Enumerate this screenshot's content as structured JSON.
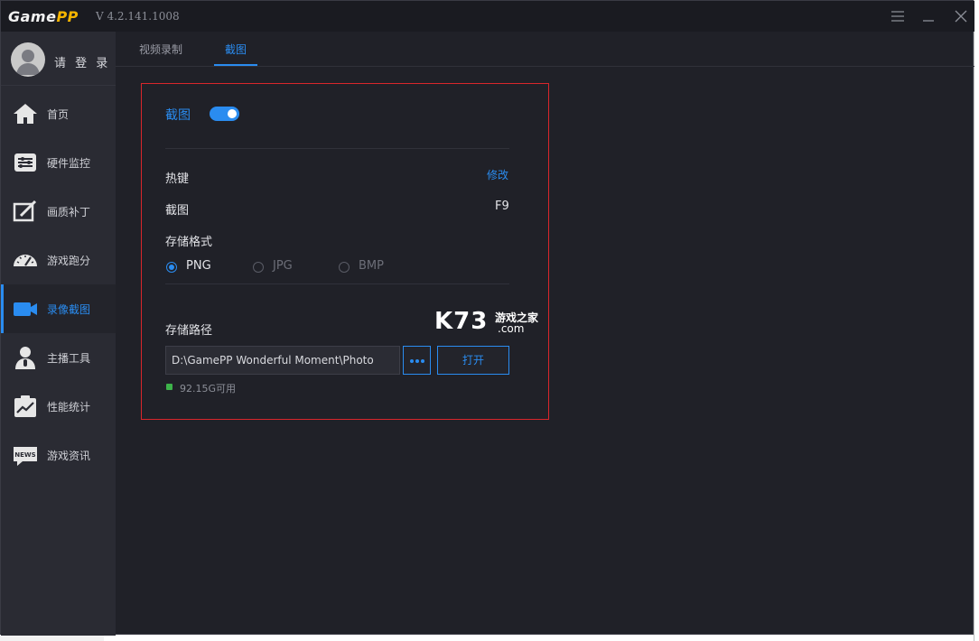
{
  "app": {
    "logo_main": "Game",
    "logo_accent": "PP",
    "version": "V 4.2.141.1008"
  },
  "user": {
    "login_label": "请 登 录"
  },
  "sidebar": {
    "items": [
      {
        "label": "首页",
        "icon": "home-icon"
      },
      {
        "label": "硬件监控",
        "icon": "hardware-monitor-icon"
      },
      {
        "label": "画质补丁",
        "icon": "quality-patch-icon"
      },
      {
        "label": "游戏跑分",
        "icon": "speedometer-icon"
      },
      {
        "label": "录像截图",
        "icon": "video-camera-icon",
        "active": true
      },
      {
        "label": "主播工具",
        "icon": "streamer-icon"
      },
      {
        "label": "性能统计",
        "icon": "stats-chart-icon"
      },
      {
        "label": "游戏资讯",
        "icon": "news-icon"
      }
    ]
  },
  "tabs": [
    {
      "label": "视频录制"
    },
    {
      "label": "截图",
      "active": true
    }
  ],
  "screenshot": {
    "title": "截图",
    "enabled": true,
    "hotkey_label": "热键",
    "edit_label": "修改",
    "shortcut_label": "截图",
    "shortcut_value": "F9",
    "format_label": "存储格式",
    "formats": [
      "PNG",
      "JPG",
      "BMP"
    ],
    "selected_format": "PNG",
    "path_label": "存储路径",
    "path_value": "D:\\GamePP Wonderful Moment\\Photo",
    "open_label": "打开",
    "free_space": "92.15G可用"
  },
  "watermark": {
    "main": "K73",
    "cn": "游戏之家",
    "domain": ".com"
  },
  "colors": {
    "accent": "#2a8cf0",
    "highlight_border": "#d9262b",
    "free_indicator": "#3db34a"
  }
}
